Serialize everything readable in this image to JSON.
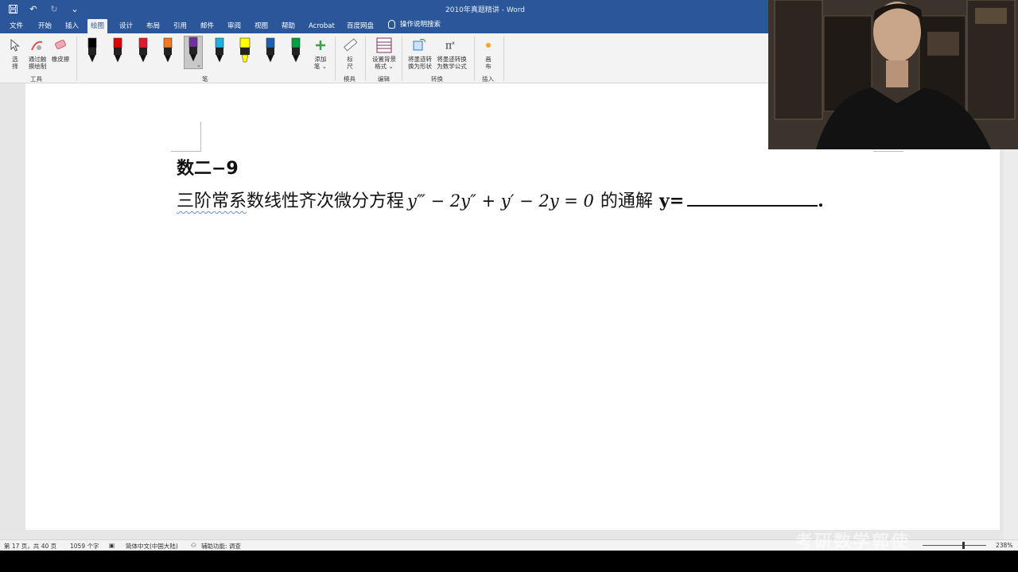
{
  "window": {
    "title": "2010年真题精讲  -  Word"
  },
  "tabs": [
    {
      "label": "文件",
      "active": false
    },
    {
      "label": "开始",
      "active": false
    },
    {
      "label": "插入",
      "active": false
    },
    {
      "label": "绘图",
      "active": true
    },
    {
      "label": "设计",
      "active": false
    },
    {
      "label": "布局",
      "active": false
    },
    {
      "label": "引用",
      "active": false
    },
    {
      "label": "邮件",
      "active": false
    },
    {
      "label": "审阅",
      "active": false
    },
    {
      "label": "视图",
      "active": false
    },
    {
      "label": "帮助",
      "active": false
    },
    {
      "label": "Acrobat",
      "active": false
    },
    {
      "label": "百度网盘",
      "active": false
    }
  ],
  "tell_me": "操作说明搜索",
  "ribbon": {
    "tools": {
      "select": "选\n择",
      "touch_draw": "通过触\n摸绘制",
      "eraser": "橡皮擦",
      "group_label": "工具"
    },
    "pens": {
      "items": [
        {
          "name": "black",
          "color": "#000000"
        },
        {
          "name": "red",
          "color": "#e00000"
        },
        {
          "name": "red2",
          "color": "#e01a2a"
        },
        {
          "name": "orange",
          "color": "#f07a20"
        },
        {
          "name": "purple",
          "color": "#7030a0",
          "selected": true
        },
        {
          "name": "cyan",
          "color": "#20b0e0"
        },
        {
          "name": "yellow-highlighter",
          "color": "#ffff00"
        },
        {
          "name": "blue",
          "color": "#1e60b0"
        },
        {
          "name": "green",
          "color": "#00a040"
        }
      ],
      "add_pen": "添加\n笔 ⌄",
      "group_label": "笔"
    },
    "stencils": {
      "ruler": "标\n尺",
      "group_label": "模具"
    },
    "edit": {
      "background": "设置背景\n格式 ⌄",
      "group_label": "编辑"
    },
    "convert": {
      "to_shape": "将墨迹转\n换为形状",
      "to_math": "将墨迹转换\n为数学公式",
      "group_label": "转换"
    },
    "insert": {
      "canvas": "画\n布",
      "group_label": "插入"
    }
  },
  "document": {
    "heading": "数二−9",
    "question_underlined": "三阶常系",
    "question_rest": "数线性齐次微分方程",
    "equation": "y‴ − 2y″ + y′ − 2y = 0",
    "after_equation": "的通解",
    "answer_prefix": "y=",
    "answer_suffix": "."
  },
  "status": {
    "page": "第 17 页，共 40 页",
    "words": "1059 个字",
    "language": "简体中文(中国大陆)",
    "accessibility": "辅助功能: 调查",
    "zoom": "238%"
  },
  "watermark": "考研数学郭使"
}
